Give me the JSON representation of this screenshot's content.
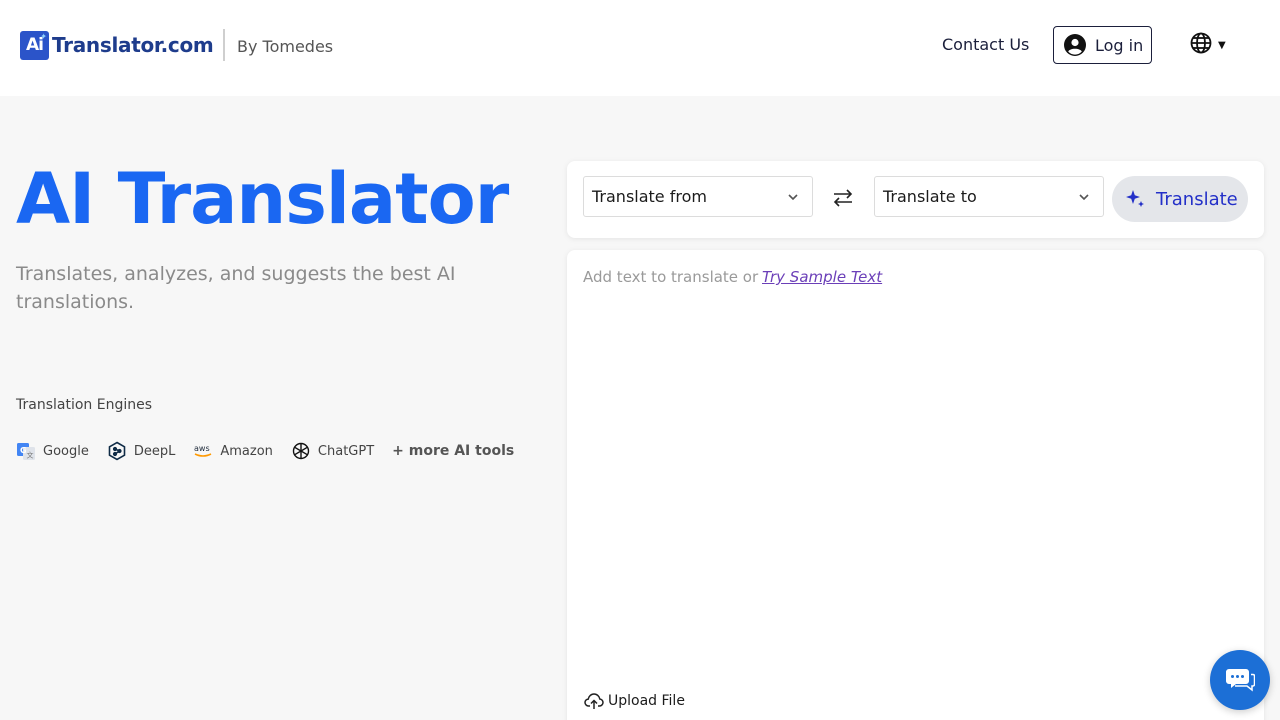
{
  "header": {
    "logo_badge": "Ai",
    "logo_text": "Translator.com",
    "by_label": "By Tomedes",
    "contact_label": "Contact Us",
    "login_label": "Log in",
    "language_icon": "globe-icon"
  },
  "hero": {
    "title": "AI Translator",
    "subtitle": "Translates, analyzes, and suggests the best AI translations.",
    "engines_title": "Translation Engines",
    "engines": [
      {
        "name": "Google",
        "icon": "google-translate-icon"
      },
      {
        "name": "DeepL",
        "icon": "deepl-icon"
      },
      {
        "name": "Amazon",
        "icon": "aws-icon"
      },
      {
        "name": "ChatGPT",
        "icon": "openai-icon"
      }
    ],
    "more_tools": "+ more AI tools"
  },
  "translator": {
    "from_placeholder": "Translate from",
    "to_placeholder": "Translate to",
    "translate_label": "Translate",
    "input_placeholder": "Add text to translate or",
    "sample_link": "Try Sample Text",
    "upload_label": "Upload File"
  },
  "colors": {
    "accent": "#1a67f2",
    "translate_text": "#2330c8",
    "link_purple": "#6b3fb8",
    "chat_blue": "#1c6fd6"
  }
}
